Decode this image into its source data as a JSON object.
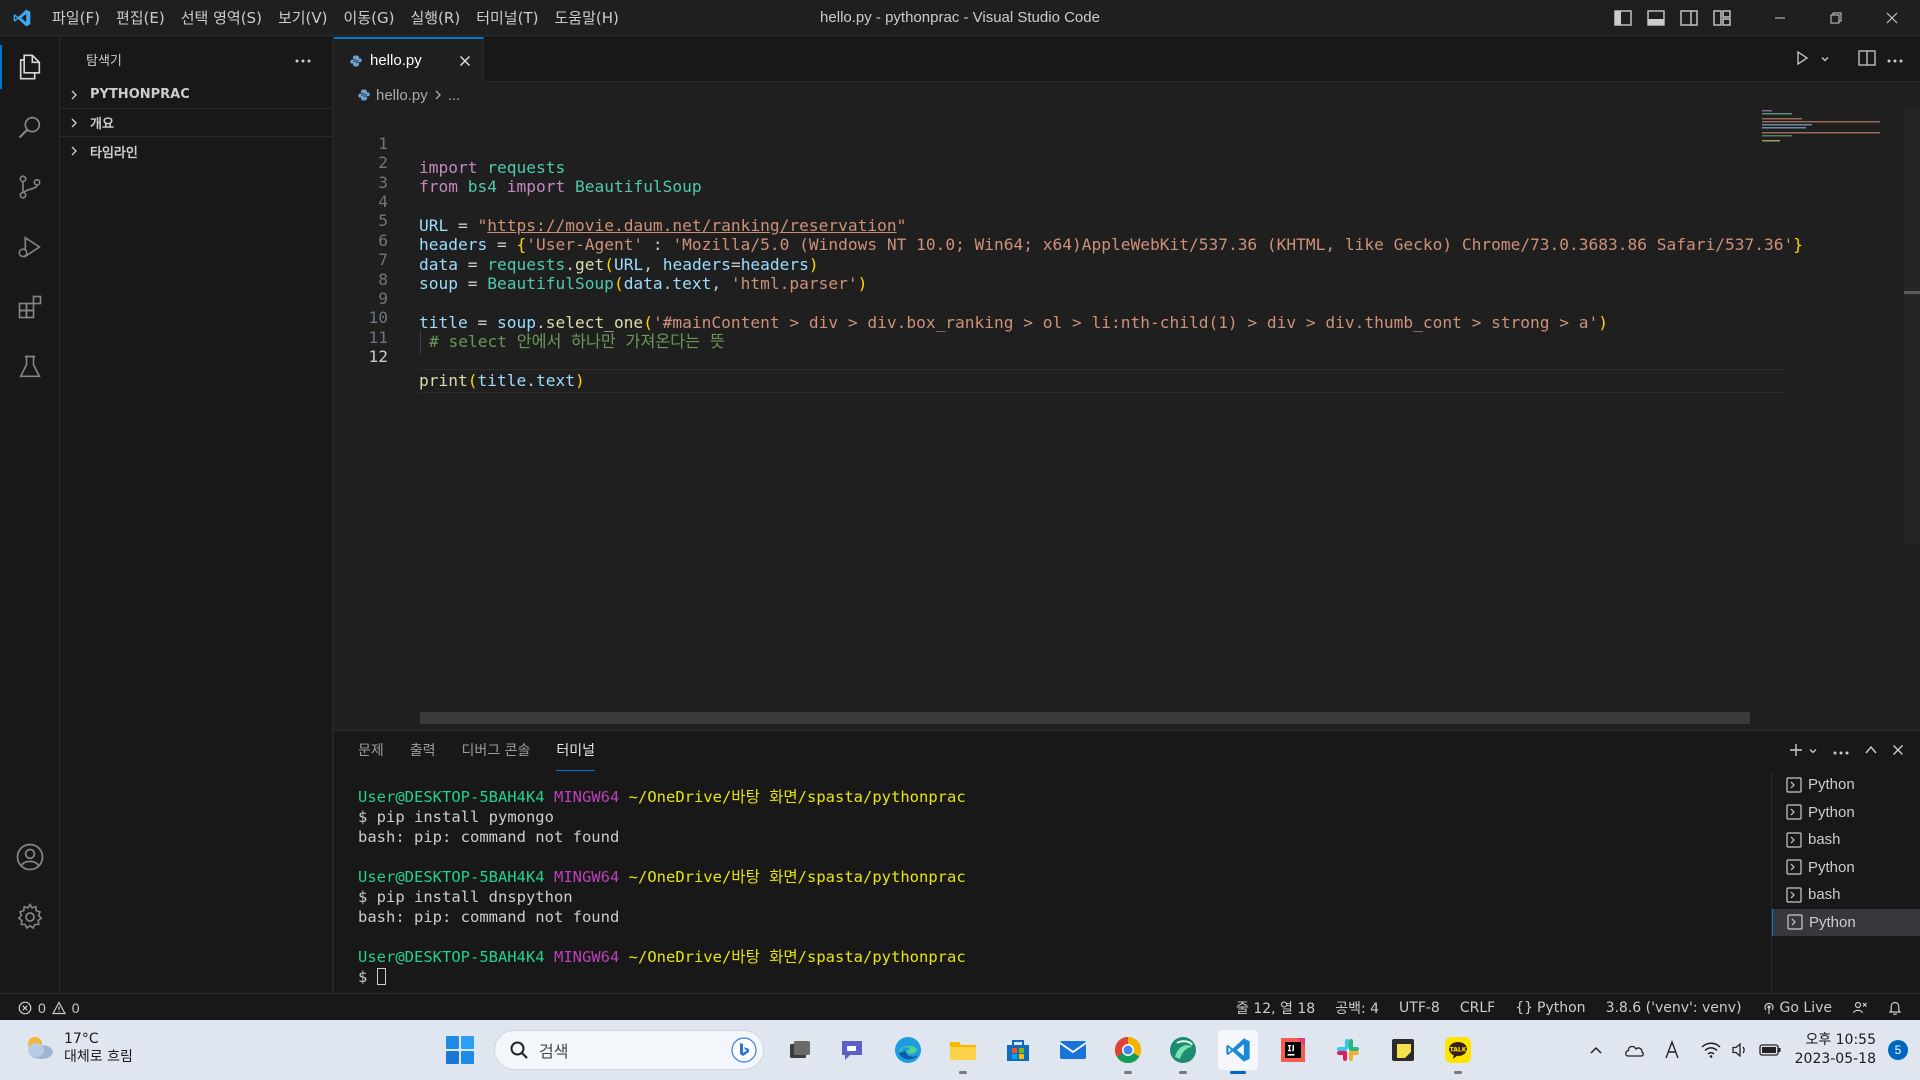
{
  "titlebar": {
    "menus": [
      "파일(F)",
      "편집(E)",
      "선택 영역(S)",
      "보기(V)",
      "이동(G)",
      "실행(R)",
      "터미널(T)",
      "도움말(H)"
    ],
    "window_title": "hello.py - pythonprac - Visual Studio Code"
  },
  "sidebar": {
    "title": "탐색기",
    "sections": [
      "PYTHONPRAC",
      "개요",
      "타임라인"
    ]
  },
  "editor": {
    "tab_label": "hello.py",
    "breadcrumb_file": "hello.py",
    "breadcrumb_more": "...",
    "current_line": 12,
    "line_numbers": [
      "1",
      "2",
      "3",
      "4",
      "5",
      "6",
      "7",
      "8",
      "9",
      "10",
      "11",
      "12"
    ],
    "code": {
      "l1_kw": "import",
      "l1_mod": "requests",
      "l2_kw1": "from",
      "l2_mod": "bs4",
      "l2_kw2": "import",
      "l2_cls": "BeautifulSoup",
      "l4_var": "URL",
      "l4_eq": " = ",
      "l4_q1": "\"",
      "l4_url": "https://movie.daum.net/ranking/reservation",
      "l4_q2": "\"",
      "l5_var": "headers",
      "l5_eq": " = ",
      "l5_open": "{",
      "l5_key": "'User-Agent'",
      "l5_colon": " : ",
      "l5_val": "'Mozilla/5.0 (Windows NT 10.0; Win64; x64)AppleWebKit/537.36 (KHTML, like Gecko) Chrome/73.0.3683.86 Safari/537.36'",
      "l5_close": "}",
      "l6_var": "data",
      "l6_eq": " = ",
      "l6_mod": "requests",
      "l6_dot": ".",
      "l6_fn": "get",
      "l6_open": "(",
      "l6_arg1": "URL",
      "l6_comma": ", ",
      "l6_kw": "headers",
      "l6_assign": "=",
      "l6_arg2": "headers",
      "l6_close": ")",
      "l7_var": "soup",
      "l7_eq": " = ",
      "l7_cls": "BeautifulSoup",
      "l7_open": "(",
      "l7_arg": "data",
      "l7_dot": ".",
      "l7_attr": "text",
      "l7_comma": ", ",
      "l7_str": "'html.parser'",
      "l7_close": ")",
      "l9_var": "title",
      "l9_eq": " = ",
      "l9_obj": "soup",
      "l9_dot": ".",
      "l9_fn": "select_one",
      "l9_open": "(",
      "l9_str": "'#mainContent > div > div.box_ranking > ol > li:nth-child(1) > div > div.thumb_cont > strong > a'",
      "l9_close": ")",
      "l10_cm": "# select 안에서 하나만 가져온다는 뜻",
      "l12_fn": "print",
      "l12_open": "(",
      "l12_var": "title",
      "l12_dot": ".",
      "l12_attr": "text",
      "l12_close": ")"
    }
  },
  "panel": {
    "tabs": [
      "문제",
      "출력",
      "디버그 콘솔",
      "터미널"
    ],
    "active_tab": "터미널",
    "terminal": {
      "user_host": "User@DESKTOP-5BAH4K4",
      "mingw": "MINGW64",
      "path": "~/OneDrive/바탕 화면/spasta/pythonprac",
      "prompt": "$ ",
      "cmd1": "pip install pymongo",
      "err1": "bash: pip: command not found",
      "cmd2": "pip install dnspython",
      "err2": "bash: pip: command not found"
    },
    "terminal_list": [
      "Python",
      "Python",
      "bash",
      "Python",
      "bash",
      "Python"
    ]
  },
  "statusbar": {
    "errors": "0",
    "warnings": "0",
    "position": "줄 12, 열 18",
    "spaces": "공백: 4",
    "encoding": "UTF-8",
    "eol": "CRLF",
    "language": "Python",
    "interpreter": "3.8.6 ('venv': venv)",
    "golive": "Go Live"
  },
  "taskbar": {
    "temperature": "17°C",
    "weather": "대체로 흐림",
    "search_placeholder": "검색",
    "time": "오후 10:55",
    "date": "2023-05-18",
    "notification_count": "5"
  },
  "colors": {
    "accent": "#0078d4",
    "editor_bg": "#1f1f1f",
    "sidebar_bg": "#181818"
  }
}
